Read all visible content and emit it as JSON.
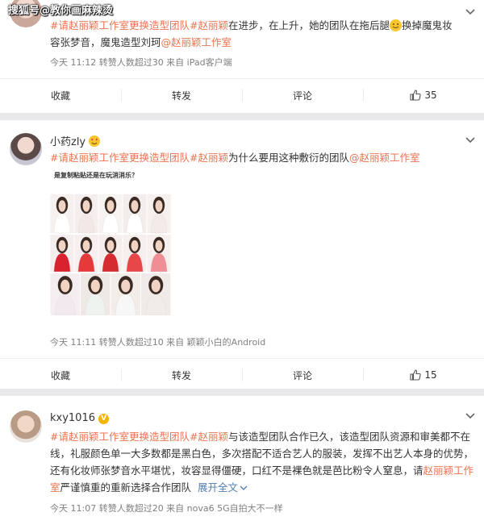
{
  "watermark": "搜狐号@教你画麻辣烫",
  "post1": {
    "text_parts": [
      {
        "t": "#请赵丽颖工作室更换造型团队#",
        "k": "tag"
      },
      {
        "t": "赵丽颖",
        "k": "tag"
      },
      {
        "t": "在进步，在上升，她的团队在拖后腿",
        "k": "plain"
      },
      {
        "t": "换掉魔鬼妆容张梦音，魔鬼造型刘珂",
        "k": "plain"
      },
      {
        "t": "@赵丽颖工作室",
        "k": "at"
      }
    ],
    "meta": "今天 11:12 转赞人数超过30  来自 iPad客户端",
    "actions": {
      "collect": "收藏",
      "forward": "转发",
      "comment": "评论",
      "like_count": "35"
    }
  },
  "post2": {
    "username": "小药zly",
    "text_parts": [
      {
        "t": "#请赵丽颖工作室更换造型团队#",
        "k": "tag"
      },
      {
        "t": "赵丽颖",
        "k": "tag"
      },
      {
        "t": "为什么要用这种敷衍的团队",
        "k": "plain"
      },
      {
        "t": "@赵丽颖工作室",
        "k": "at"
      }
    ],
    "image_caption": "是复制粘贴还是在玩消消乐？",
    "meta": "今天 11:11 转赞人数超过10  来自 颖颖小白的Android",
    "actions": {
      "collect": "收藏",
      "forward": "转发",
      "comment": "评论",
      "like_count": "15"
    }
  },
  "post3": {
    "username": "kxy1016",
    "verified": "V",
    "line1_parts": [
      {
        "t": "#请赵丽颖工作室更换造型团队#",
        "k": "tag"
      },
      {
        "t": "赵丽颖",
        "k": "tag"
      },
      {
        "t": "与该造型团队合作已久，该造型团队资源和审美都不在",
        "k": "plain"
      }
    ],
    "line2": "线，礼服颜色单一大多数都是黑白色，多次搭配不适合艺人的服装，发挥不出艺人本身的优势，",
    "line3_parts": [
      {
        "t": "还有化妆师张梦音水平堪忧，妆容显得僵硬，口红不是裸色就是芭比粉令人窒息，请",
        "k": "plain"
      },
      {
        "t": "赵丽颖工作",
        "k": "at"
      }
    ],
    "line4_parts": [
      {
        "t": "室",
        "k": "at"
      },
      {
        "t": "严谨慎重的重新选择合作团队",
        "k": "plain"
      }
    ],
    "expand": "展开全文",
    "meta": "今天 11:07 转赞人数超过20  来自 nova6 5G自拍大不一样"
  },
  "colors": {
    "accent": "#eb7350",
    "link_blue": "#507daf",
    "meta_gray": "#808080",
    "bg": "#e9e9ec"
  },
  "icons": [
    "chevron-down-icon",
    "thumb-up-icon",
    "smile-emoji-icon",
    "verified-badge-icon"
  ]
}
